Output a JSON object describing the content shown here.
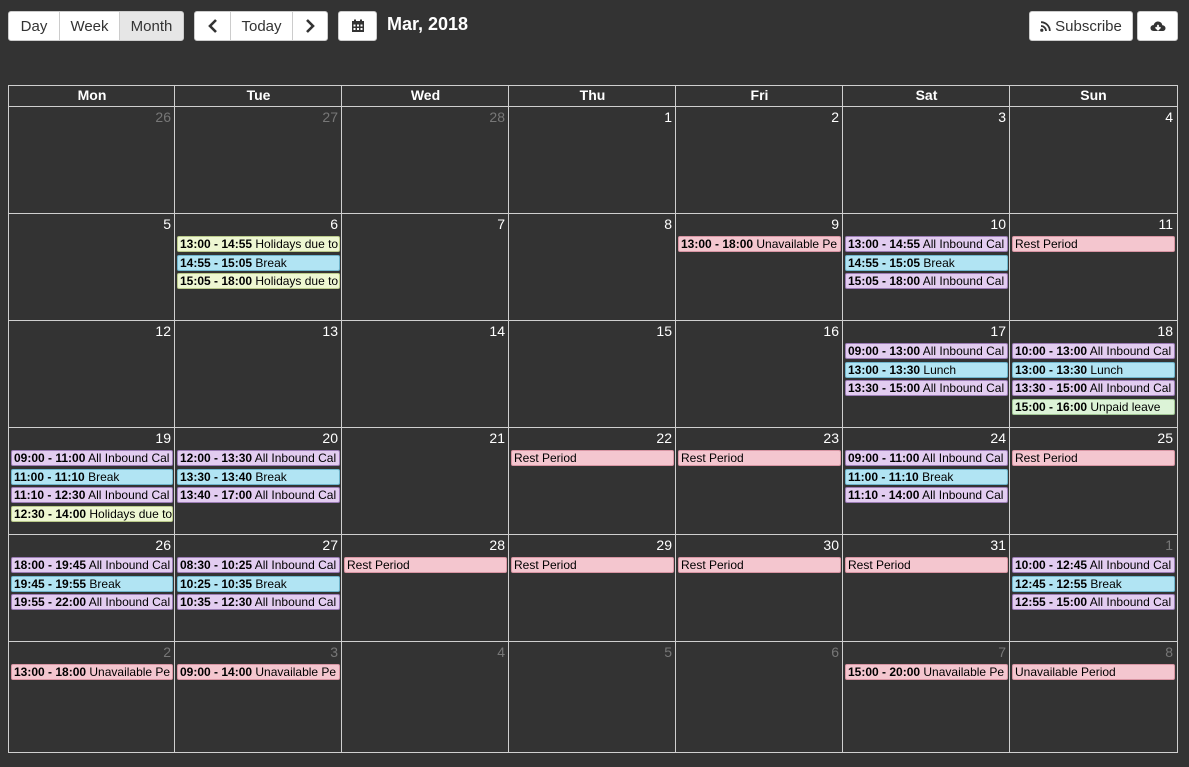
{
  "toolbar": {
    "day": "Day",
    "week": "Week",
    "month": "Month",
    "active_view": "Month",
    "today": "Today",
    "subscribe": "Subscribe"
  },
  "title": "Mar, 2018",
  "dow": [
    "Mon",
    "Tue",
    "Wed",
    "Thu",
    "Fri",
    "Sat",
    "Sun"
  ],
  "weeks": [
    {
      "days": [
        {
          "n": "26",
          "other": true,
          "events": []
        },
        {
          "n": "27",
          "other": true,
          "events": []
        },
        {
          "n": "28",
          "other": true,
          "events": []
        },
        {
          "n": "1",
          "events": []
        },
        {
          "n": "2",
          "events": []
        },
        {
          "n": "3",
          "events": []
        },
        {
          "n": "4",
          "events": []
        }
      ]
    },
    {
      "days": [
        {
          "n": "5",
          "events": []
        },
        {
          "n": "6",
          "events": [
            {
              "time": "13:00 - 14:55",
              "label": "Holidays due to",
              "color": "yellow"
            },
            {
              "time": "14:55 - 15:05",
              "label": "Break",
              "color": "blue"
            },
            {
              "time": "15:05 - 18:00",
              "label": "Holidays due to",
              "color": "yellow"
            }
          ]
        },
        {
          "n": "7",
          "events": []
        },
        {
          "n": "8",
          "events": []
        },
        {
          "n": "9",
          "events": [
            {
              "time": "13:00 - 18:00",
              "label": "Unavailable Pe",
              "color": "pink"
            }
          ]
        },
        {
          "n": "10",
          "events": [
            {
              "time": "13:00 - 14:55",
              "label": "All Inbound Cal",
              "color": "purple"
            },
            {
              "time": "14:55 - 15:05",
              "label": "Break",
              "color": "blue"
            },
            {
              "time": "15:05 - 18:00",
              "label": "All Inbound Cal",
              "color": "purple"
            }
          ]
        },
        {
          "n": "11",
          "events": [
            {
              "time": "",
              "label": "Rest Period",
              "color": "pink"
            }
          ]
        }
      ]
    },
    {
      "days": [
        {
          "n": "12",
          "events": []
        },
        {
          "n": "13",
          "events": []
        },
        {
          "n": "14",
          "events": []
        },
        {
          "n": "15",
          "events": []
        },
        {
          "n": "16",
          "events": []
        },
        {
          "n": "17",
          "events": [
            {
              "time": "09:00 - 13:00",
              "label": "All Inbound Cal",
              "color": "purple"
            },
            {
              "time": "13:00 - 13:30",
              "label": "Lunch",
              "color": "blue"
            },
            {
              "time": "13:30 - 15:00",
              "label": "All Inbound Cal",
              "color": "purple"
            }
          ]
        },
        {
          "n": "18",
          "events": [
            {
              "time": "10:00 - 13:00",
              "label": "All Inbound Cal",
              "color": "purple"
            },
            {
              "time": "13:00 - 13:30",
              "label": "Lunch",
              "color": "blue"
            },
            {
              "time": "13:30 - 15:00",
              "label": "All Inbound Cal",
              "color": "purple"
            },
            {
              "time": "15:00 - 16:00",
              "label": "Unpaid leave",
              "color": "green"
            }
          ]
        }
      ]
    },
    {
      "days": [
        {
          "n": "19",
          "events": [
            {
              "time": "09:00 - 11:00",
              "label": "All Inbound Cal",
              "color": "purple"
            },
            {
              "time": "11:00 - 11:10",
              "label": "Break",
              "color": "blue"
            },
            {
              "time": "11:10 - 12:30",
              "label": "All Inbound Cal",
              "color": "purple"
            },
            {
              "time": "12:30 - 14:00",
              "label": "Holidays due to",
              "color": "yellow"
            }
          ]
        },
        {
          "n": "20",
          "events": [
            {
              "time": "12:00 - 13:30",
              "label": "All Inbound Cal",
              "color": "purple"
            },
            {
              "time": "13:30 - 13:40",
              "label": "Break",
              "color": "blue"
            },
            {
              "time": "13:40 - 17:00",
              "label": "All Inbound Cal",
              "color": "purple"
            }
          ]
        },
        {
          "n": "21",
          "events": []
        },
        {
          "n": "22",
          "events": [
            {
              "time": "",
              "label": "Rest Period",
              "color": "pink"
            }
          ]
        },
        {
          "n": "23",
          "events": [
            {
              "time": "",
              "label": "Rest Period",
              "color": "pink"
            }
          ]
        },
        {
          "n": "24",
          "events": [
            {
              "time": "09:00 - 11:00",
              "label": "All Inbound Cal",
              "color": "purple"
            },
            {
              "time": "11:00 - 11:10",
              "label": "Break",
              "color": "blue"
            },
            {
              "time": "11:10 - 14:00",
              "label": "All Inbound Cal",
              "color": "purple"
            }
          ]
        },
        {
          "n": "25",
          "events": [
            {
              "time": "",
              "label": "Rest Period",
              "color": "pink"
            }
          ]
        }
      ]
    },
    {
      "days": [
        {
          "n": "26",
          "events": [
            {
              "time": "18:00 - 19:45",
              "label": "All Inbound Cal",
              "color": "purple"
            },
            {
              "time": "19:45 - 19:55",
              "label": "Break",
              "color": "blue"
            },
            {
              "time": "19:55 - 22:00",
              "label": "All Inbound Cal",
              "color": "purple"
            }
          ]
        },
        {
          "n": "27",
          "events": [
            {
              "time": "08:30 - 10:25",
              "label": "All Inbound Cal",
              "color": "purple"
            },
            {
              "time": "10:25 - 10:35",
              "label": "Break",
              "color": "blue"
            },
            {
              "time": "10:35 - 12:30",
              "label": "All Inbound Cal",
              "color": "purple"
            }
          ]
        },
        {
          "n": "28",
          "events": [
            {
              "time": "",
              "label": "Rest Period",
              "color": "pink"
            }
          ]
        },
        {
          "n": "29",
          "events": [
            {
              "time": "",
              "label": "Rest Period",
              "color": "pink"
            }
          ]
        },
        {
          "n": "30",
          "events": [
            {
              "time": "",
              "label": "Rest Period",
              "color": "pink"
            }
          ]
        },
        {
          "n": "31",
          "events": [
            {
              "time": "",
              "label": "Rest Period",
              "color": "pink"
            }
          ]
        },
        {
          "n": "1",
          "other": true,
          "events": [
            {
              "time": "10:00 - 12:45",
              "label": "All Inbound Cal",
              "color": "purple"
            },
            {
              "time": "12:45 - 12:55",
              "label": "Break",
              "color": "blue"
            },
            {
              "time": "12:55 - 15:00",
              "label": "All Inbound Cal",
              "color": "purple"
            }
          ]
        }
      ]
    },
    {
      "days": [
        {
          "n": "2",
          "other": true,
          "events": [
            {
              "time": "13:00 - 18:00",
              "label": "Unavailable Pe",
              "color": "pink"
            }
          ]
        },
        {
          "n": "3",
          "other": true,
          "events": [
            {
              "time": "09:00 - 14:00",
              "label": "Unavailable Pe",
              "color": "pink"
            }
          ]
        },
        {
          "n": "4",
          "other": true,
          "events": []
        },
        {
          "n": "5",
          "other": true,
          "events": []
        },
        {
          "n": "6",
          "other": true,
          "events": []
        },
        {
          "n": "7",
          "other": true,
          "events": [
            {
              "time": "15:00 - 20:00",
              "label": "Unavailable Pe",
              "color": "pink"
            }
          ]
        },
        {
          "n": "8",
          "other": true,
          "events": [
            {
              "time": "",
              "label": "Unavailable Period",
              "color": "pink"
            }
          ]
        }
      ]
    }
  ]
}
